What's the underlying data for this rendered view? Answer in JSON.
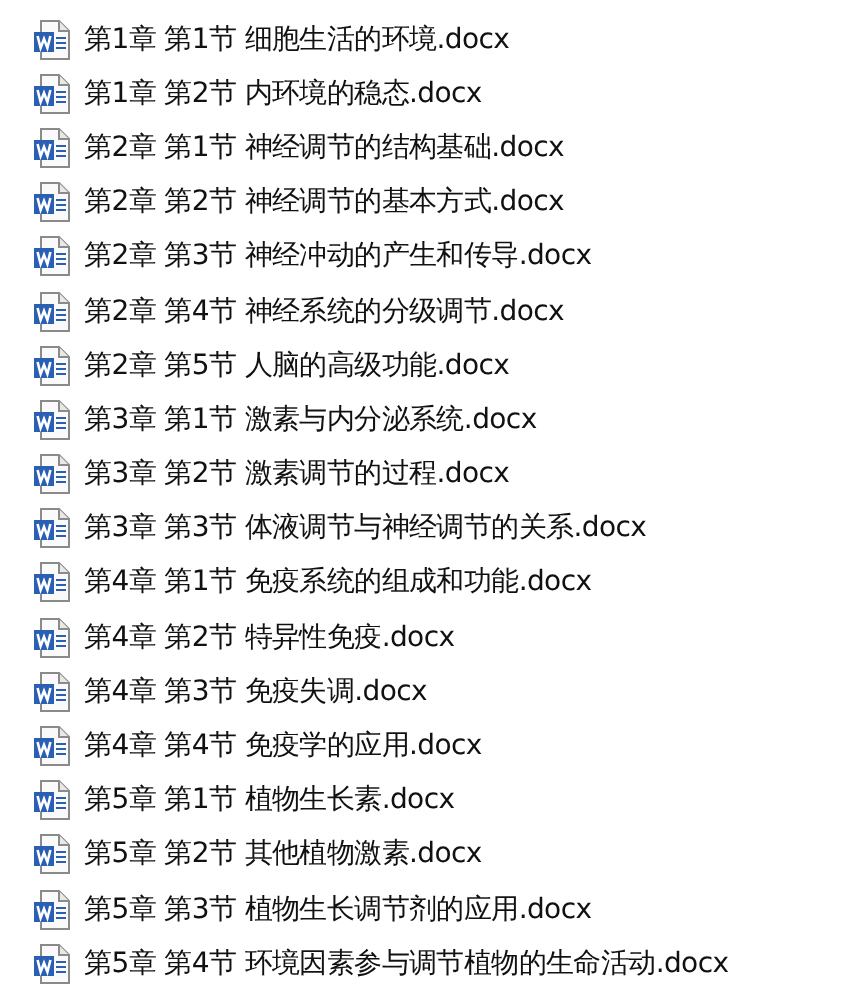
{
  "files": [
    {
      "name": "第1章 第1节 细胞生活的环境.docx"
    },
    {
      "name": "第1章 第2节 内环境的稳态.docx"
    },
    {
      "name": "第2章 第1节 神经调节的结构基础.docx"
    },
    {
      "name": "第2章 第2节 神经调节的基本方式.docx"
    },
    {
      "name": "第2章 第3节 神经冲动的产生和传导.docx"
    },
    {
      "name": "第2章 第4节 神经系统的分级调节.docx"
    },
    {
      "name": "第2章 第5节 人脑的高级功能.docx"
    },
    {
      "name": "第3章 第1节 激素与内分泌系统.docx"
    },
    {
      "name": "第3章 第2节 激素调节的过程.docx"
    },
    {
      "name": "第3章 第3节 体液调节与神经调节的关系.docx"
    },
    {
      "name": "第4章 第1节 免疫系统的组成和功能.docx"
    },
    {
      "name": "第4章 第2节 特异性免疫.docx"
    },
    {
      "name": "第4章 第3节 免疫失调.docx"
    },
    {
      "name": "第4章 第4节 免疫学的应用.docx"
    },
    {
      "name": "第5章 第1节 植物生长素.docx"
    },
    {
      "name": "第5章 第2节 其他植物激素.docx"
    },
    {
      "name": "第5章 第3节 植物生长调节剂的应用.docx"
    },
    {
      "name": "第5章 第4节 环境因素参与调节植物的生命活动.docx"
    }
  ]
}
